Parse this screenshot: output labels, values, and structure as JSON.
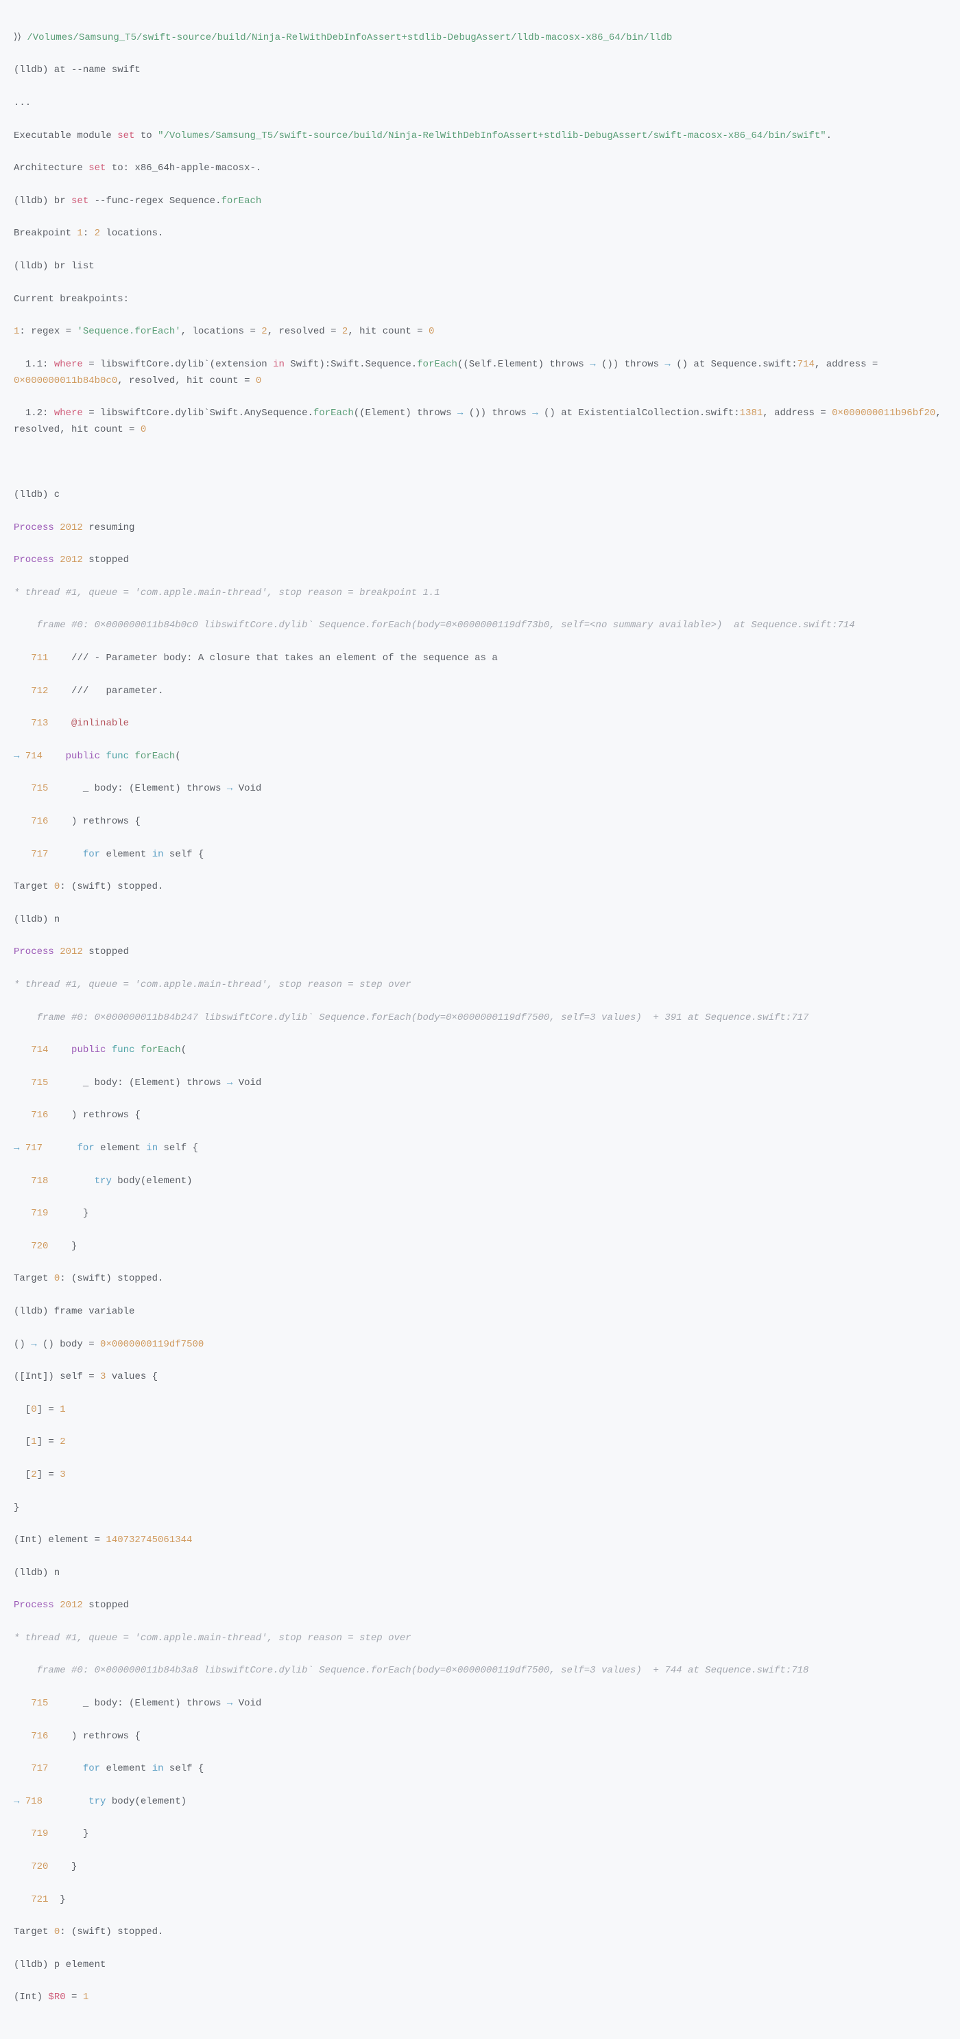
{
  "cmd1_prefix": "⟩⟩",
  "cmd1_path": "/Volumes/Samsung_T5/swift-source/build/Ninja-RelWithDebInfoAssert+stdlib-DebugAssert/lldb-macosx-x86_64/bin/lldb",
  "at_prompt": "(lldb) at --name swift",
  "ellipsis": "...",
  "exec_pre": "Executable module ",
  "exec_set": "set",
  "exec_to": " to ",
  "exec_path": "\"/Volumes/Samsung_T5/swift-source/build/Ninja-RelWithDebInfoAssert+stdlib-DebugAssert/swift-macosx-x86_64/bin/swift\"",
  "exec_dot": ".",
  "arch_pre": "Architecture ",
  "arch_set": "set",
  "arch_post": " to: x86_64h-apple-macosx-.",
  "br_set_pre": "(lldb) br ",
  "br_set_kw": "set",
  "br_set_flag": " --func-regex Sequence.",
  "br_set_fn": "forEach",
  "bp_line_pre": "Breakpoint ",
  "bp_line_1": "1",
  "bp_line_mid": ": ",
  "bp_line_2": "2",
  "bp_line_post": " locations.",
  "br_list": "(lldb) br list",
  "curr_bp": "Current breakpoints:",
  "bp1_idx": "1",
  "bp1_a": ": regex = ",
  "bp1_regex": "'Sequence.forEach'",
  "bp1_b": ", locations = ",
  "bp1_loc": "2",
  "bp1_c": ", resolved = ",
  "bp1_res": "2",
  "bp1_d": ", hit count = ",
  "bp1_hit": "0",
  "bp11_a": "  1.1: ",
  "bp11_where": "where",
  "bp11_b": " = libswiftCore.dylib`(extension ",
  "bp11_in": "in",
  "bp11_c": " Swift):Swift.Sequence.",
  "bp11_fn": "forEach",
  "bp11_d": "((Self.Element) throws ",
  "bp11_arr1": "→",
  "bp11_e": " ()) throws ",
  "bp11_arr2": "→",
  "bp11_f": " () at Sequence.swift:",
  "bp11_ln": "714",
  "bp11_g": ", address = ",
  "bp11_addr": "0×000000011b84b0c0",
  "bp11_h": ", resolved, hit count = ",
  "bp11_hit": "0",
  "bp12_a": "  1.2: ",
  "bp12_where": "where",
  "bp12_b": " = libswiftCore.dylib`Swift.AnySequence.",
  "bp12_fn": "forEach",
  "bp12_c": "((Element) throws ",
  "bp12_arr1": "→",
  "bp12_d": " ()) throws ",
  "bp12_arr2": "→",
  "bp12_e": " () at ExistentialCollection.swift:",
  "bp12_ln": "1381",
  "bp12_f": ", address = ",
  "bp12_addr": "0×000000011b96bf20",
  "bp12_g": ", resolved, hit count = ",
  "bp12_hit": "0",
  "c_cmd": "(lldb) c",
  "proc_label": "Process ",
  "proc_id1": "2012",
  "proc_resuming": " resuming",
  "proc_stopped": " stopped",
  "thread1": "* thread #1, queue = 'com.apple.main-thread', stop reason = breakpoint 1.1",
  "frame1": "    frame #0: 0×000000011b84b0c0 libswiftCore.dylib` Sequence.forEach(body=0×0000000119df73b0, self=<no summary available>)  at Sequence.swift:714",
  "src1_711n": "711",
  "src1_711": "    /// - Parameter body: A closure that takes an element of the sequence as a",
  "src1_712n": "712",
  "src1_712": "    ///   parameter.",
  "src1_713n": "713",
  "src1_713": "@inlinable",
  "src1_714n": "714",
  "src1_714a": "public",
  "src1_714b": "func",
  "src1_714c": "forEach",
  "src1_714d": "(",
  "src1_715n": "715",
  "src1_715a": "      _ body: (Element) throws ",
  "src1_715arr": "→",
  "src1_715b": " Void",
  "src1_716n": "716",
  "src1_716": "    ) rethrows {",
  "src1_717n": "717",
  "src1_717a": "for",
  "src1_717b": " element ",
  "src1_717c": "in",
  "src1_717d": " self {",
  "target_stopped_pre": "Target ",
  "target_stopped_0": "0",
  "target_stopped_post": ": (swift) stopped.",
  "n_cmd": "(lldb) n",
  "thread2": "* thread #1, queue = 'com.apple.main-thread', stop reason = step over",
  "frame2": "    frame #0: 0×000000011b84b247 libswiftCore.dylib` Sequence.forEach(body=0×0000000119df7500, self=3 values)  + 391 at Sequence.swift:717",
  "src2_714n": "714",
  "src2_715n": "715",
  "src2_716n": "716",
  "src2_717n": "717",
  "src2_718n": "718",
  "src2_718a": "try",
  "src2_718b": " body(element)",
  "src2_719n": "719",
  "src2_719": "      }",
  "src2_720n": "720",
  "src2_720": "    }",
  "fv_cmd": "(lldb) frame variable",
  "fv_body_a": "() ",
  "fv_body_arr": "→",
  "fv_body_b": " () body = ",
  "fv_body_val": "0×0000000119df7500",
  "fv_self_a": "([Int]) self = ",
  "fv_self_n": "3",
  "fv_self_b": " values {",
  "fv_i0a": "  [",
  "fv_i0n": "0",
  "fv_i0b": "] = ",
  "fv_i0v": "1",
  "fv_i1n": "1",
  "fv_i1v": "2",
  "fv_i2n": "2",
  "fv_i2v": "3",
  "fv_close": "}",
  "fv_elem_a": "(Int) element = ",
  "fv_elem_v": "140732745061344",
  "frame3": "    frame #0: 0×000000011b84b3a8 libswiftCore.dylib` Sequence.forEach(body=0×0000000119df7500, self=3 values)  + 744 at Sequence.swift:718",
  "src3_715n": "715",
  "src3_716n": "716",
  "src3_717n": "717",
  "src3_718n": "718",
  "src3_719n": "719",
  "src3_720n": "720",
  "src3_721n": "721",
  "src3_721": "  }",
  "p_elem": "(lldb) p element",
  "p_res_a": "(Int) ",
  "p_res_r": "$R0",
  "p_res_b": " = ",
  "p_res_v": "1"
}
